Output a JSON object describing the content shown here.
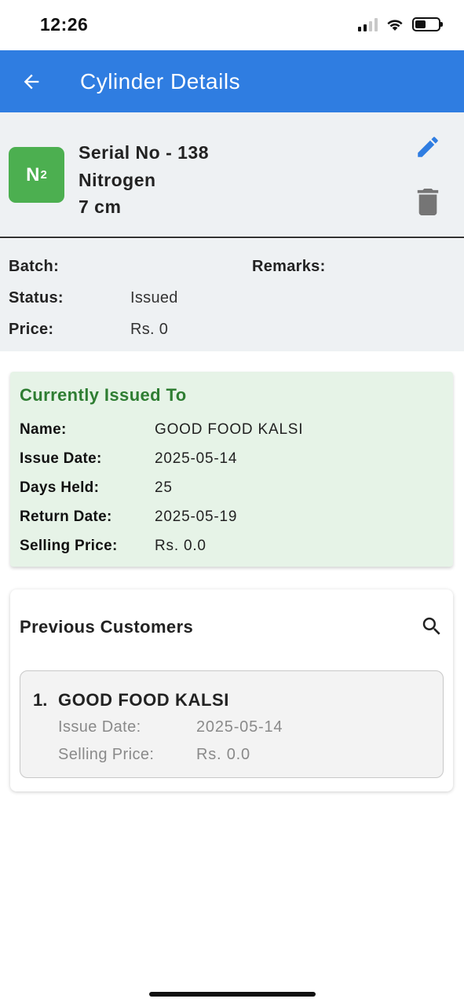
{
  "status_bar": {
    "time": "12:26"
  },
  "app_bar": {
    "title": "Cylinder Details"
  },
  "cylinder": {
    "badge": {
      "symbol": "N",
      "subscript": "2",
      "color": "#4caf50"
    },
    "serial": "Serial No - 138",
    "gas": "Nitrogen",
    "size": "7 cm"
  },
  "info": {
    "batch_label": "Batch:",
    "batch_value": "",
    "remarks_label": "Remarks:",
    "remarks_value": "",
    "status_label": "Status:",
    "status_value": "Issued",
    "price_label": "Price:",
    "price_value": "Rs. 0"
  },
  "current_issue": {
    "title": "Currently Issued To",
    "name_label": "Name:",
    "name": "GOOD FOOD KALSI",
    "issue_date_label": "Issue Date:",
    "issue_date": "2025-05-14",
    "days_held_label": "Days Held:",
    "days_held": "25",
    "return_date_label": "Return Date:",
    "return_date": "2025-05-19",
    "selling_price_label": "Selling Price:",
    "selling_price": "Rs. 0.0"
  },
  "previous_customers": {
    "title": "Previous Customers",
    "items": [
      {
        "index": "1.",
        "name": "GOOD FOOD KALSI",
        "issue_date_label": "Issue Date:",
        "issue_date": "2025-05-14",
        "selling_price_label": "Selling Price:",
        "selling_price": "Rs. 0.0"
      }
    ]
  },
  "colors": {
    "app_bar": "#2f7de1",
    "accent_green": "#2e7d32",
    "issued_bg": "#e6f3e7",
    "edit_icon": "#2f7de1",
    "delete_icon": "#757575"
  }
}
